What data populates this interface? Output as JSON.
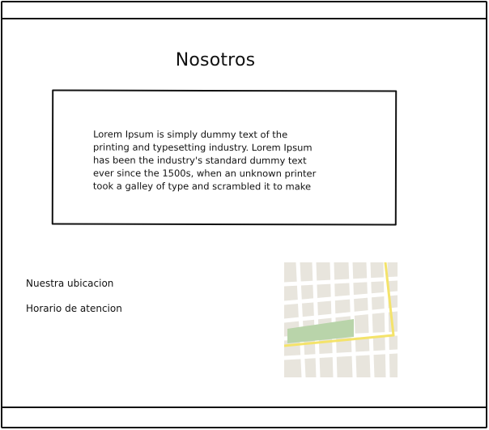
{
  "page": {
    "title": "Nosotros",
    "about_text": "Lorem Ipsum is simply dummy text of the\nprinting and typesetting industry. Lorem Ipsum\nhas been the industry's standard dummy text\never since the 1500s, when an unknown printer\ntook a galley of type and scrambled it to make"
  },
  "info": {
    "location_label": "Nuestra ubicacion",
    "hours_label": "Horario de atencion"
  },
  "colors": {
    "map_background": "#e8e5dd",
    "map_road": "#ffffff",
    "map_highlight_road": "#f4e36a",
    "map_park": "#b9d4aa",
    "frame": "#111111"
  },
  "icons": {
    "map": "map-icon"
  }
}
